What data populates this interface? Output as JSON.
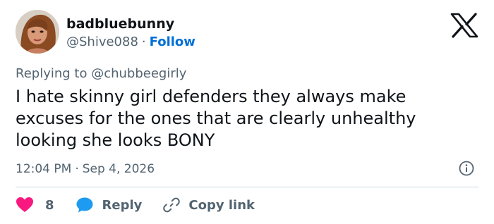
{
  "user": {
    "display_name": "badbluebunny",
    "handle": "@Shive088",
    "separator": "·",
    "follow_label": "Follow",
    "avatar_icon": "profile-photo"
  },
  "brand": {
    "logo_icon": "x-logo"
  },
  "tweet": {
    "replying_to": "Replying to @chubbeegirly",
    "text": "I hate skinny girl defenders they always make excuses for the ones that are clearly unhealthy looking she looks BONY",
    "time": "12:04 PM",
    "separator": "·",
    "date": "Sep 4, 2026"
  },
  "actions": {
    "like_count": "8",
    "reply_label": "Reply",
    "copy_link_label": "Copy link"
  },
  "colors": {
    "text": "#0f1419",
    "muted": "#536471",
    "link": "#006fd6",
    "heart": "#f91880",
    "reply_bubble": "#1d9bf0",
    "divider": "#cfd9de"
  }
}
